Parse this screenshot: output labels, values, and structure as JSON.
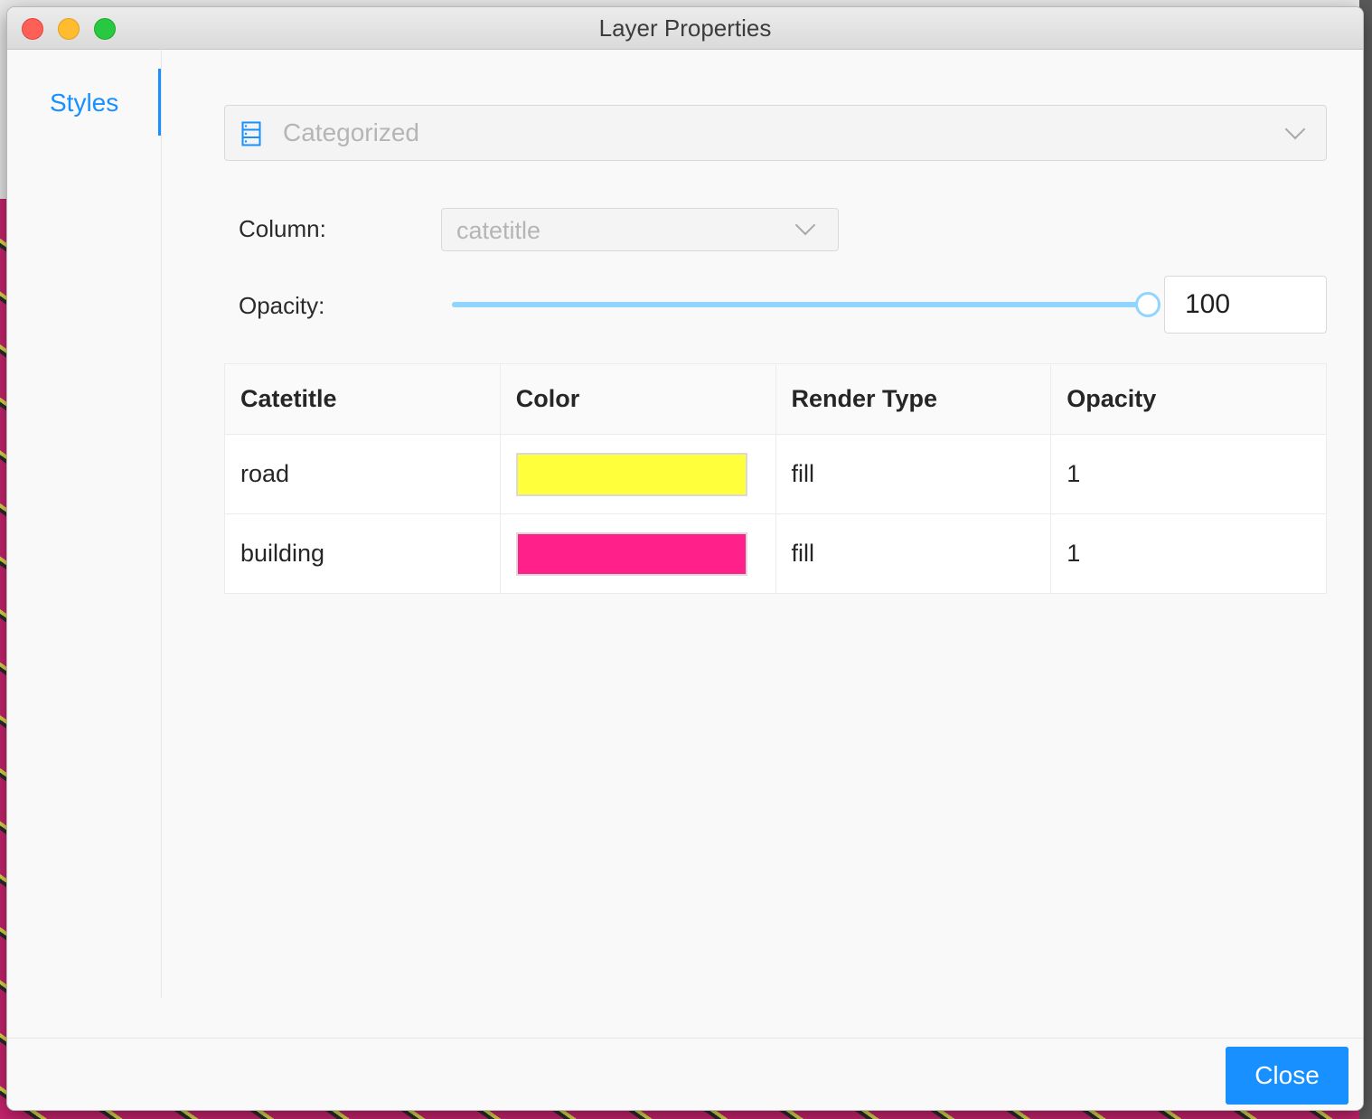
{
  "window": {
    "title": "Layer Properties"
  },
  "sidebar": {
    "items": [
      {
        "label": "Styles",
        "active": true
      }
    ]
  },
  "style": {
    "render_type": {
      "value": "Categorized",
      "icon": "list-icon"
    },
    "column": {
      "label": "Column:",
      "value": "catetitle"
    },
    "opacity": {
      "label": "Opacity:",
      "value": "100",
      "slider_percent": 100
    }
  },
  "table": {
    "headers": [
      "Catetitle",
      "Color",
      "Render Type",
      "Opacity"
    ],
    "rows": [
      {
        "catetitle": "road",
        "color": "#ffff3b",
        "render_type": "fill",
        "opacity": "1"
      },
      {
        "catetitle": "building",
        "color": "#ff2189",
        "render_type": "fill",
        "opacity": "1"
      }
    ]
  },
  "footer": {
    "close_label": "Close"
  },
  "colors": {
    "accent": "#1890ff",
    "slider": "#91d5ff"
  }
}
